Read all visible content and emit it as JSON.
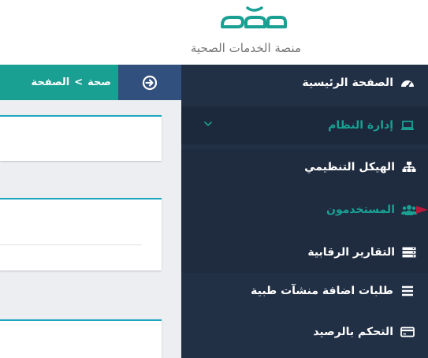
{
  "brand": {
    "logo_text": "صحة",
    "subtitle": "منصة الخدمات الصحية",
    "accent": "#1aa093"
  },
  "topbar": {
    "breadcrumb": [
      "صحة",
      ">",
      "الصفحة"
    ],
    "toggle_icon": "arrow-circle-right-icon"
  },
  "sidebar": {
    "items": [
      {
        "label": "الصفحة الرئيسية",
        "icon": "dashboard-icon"
      },
      {
        "label": "إدارة النظام",
        "icon": "laptop-icon",
        "expanded": true
      },
      {
        "label": "الهيكل التنظيمي",
        "icon": "sitemap-icon"
      },
      {
        "label": "المستخدمون",
        "icon": "users-icon"
      },
      {
        "label": "التقارير الرقابية",
        "icon": "server-icon"
      },
      {
        "label": "طلبات اضافة منشآت طبية",
        "icon": "bars-icon"
      },
      {
        "label": "التحكم بالرصيد",
        "icon": "credit-card-icon"
      }
    ]
  }
}
